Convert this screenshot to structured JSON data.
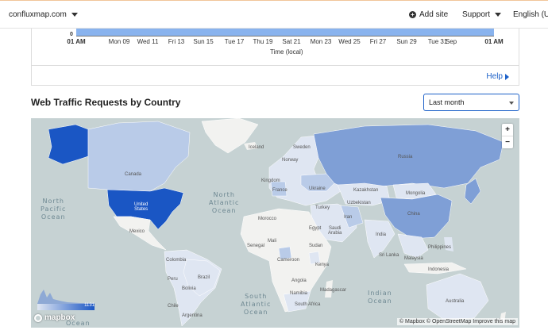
{
  "topbar": {
    "site": "confluxmap.com",
    "add_site": "Add site",
    "support": "Support",
    "language": "English (US"
  },
  "traffic_chart": {
    "y_zero": "0",
    "x_ticks": [
      "01 AM",
      "Mon 09",
      "Wed 11",
      "Fri 13",
      "Sun 15",
      "Tue 17",
      "Thu 19",
      "Sat 21",
      "Mon 23",
      "Wed 25",
      "Fri 27",
      "Sun 29",
      "Tue 31",
      "Sep",
      "01 AM"
    ],
    "x_axis_title": "Time (local)",
    "help": "Help"
  },
  "country_section": {
    "title": "Web Traffic Requests by Country",
    "range_select": "Last month"
  },
  "map": {
    "oceans": {
      "north_pacific": "North\nPacific\nOcean",
      "north_atlantic": "North\nAtlantic\nOcean",
      "south_atlantic": "South\nAtlantic\nOcean",
      "indian": "Indian\nOcean",
      "southern": "Ocean"
    },
    "countries": {
      "iceland": "Iceland",
      "sweden": "Sweden",
      "norway": "Norway",
      "canada": "Canada",
      "united_states": "United\nStates",
      "mexico": "Mexico",
      "kingdom": "Kingdom",
      "france": "France",
      "ukraine": "Ukraine",
      "russia": "Russia",
      "kazakhstan": "Kazakhstan",
      "mongolia": "Mongolia",
      "uzbekistan": "Uzbekistan",
      "turkey": "Turkey",
      "iran": "Iran",
      "china": "China",
      "morocco": "Morocco",
      "egypt": "Egypt",
      "saudi_arabia": "Saudi\nArabia",
      "india": "India",
      "mali": "Mali",
      "senegal": "Senegal",
      "sudan": "Sudan",
      "cameroon": "Cameroon",
      "kenya": "Kenya",
      "colombia": "Colombia",
      "peru": "Peru",
      "brazil": "Brazil",
      "bolivia": "Bolivia",
      "angola": "Angola",
      "namibia": "Namibia",
      "south_africa": "South Africa",
      "madagascar": "Madagascar",
      "sri_lanka": "Sri Lanka",
      "philippines": "Philippines",
      "malaysia": "Malaysia",
      "indonesia": "Indonesia",
      "australia": "Australia",
      "argentina": "Argentina",
      "chile": "Chile"
    },
    "legend_max": "1131",
    "logo": "mapbox",
    "attribution": "© Mapbox © OpenStreetMap Improve this map",
    "zoom_in": "+",
    "zoom_out": "−",
    "colors": {
      "ocean": "#c6d2d3",
      "land_none": "#f2f2f0",
      "low": "#dfe6f2",
      "light": "#b9cbe8",
      "mid": "#7f9fd6",
      "high": "#1a56c4"
    }
  }
}
